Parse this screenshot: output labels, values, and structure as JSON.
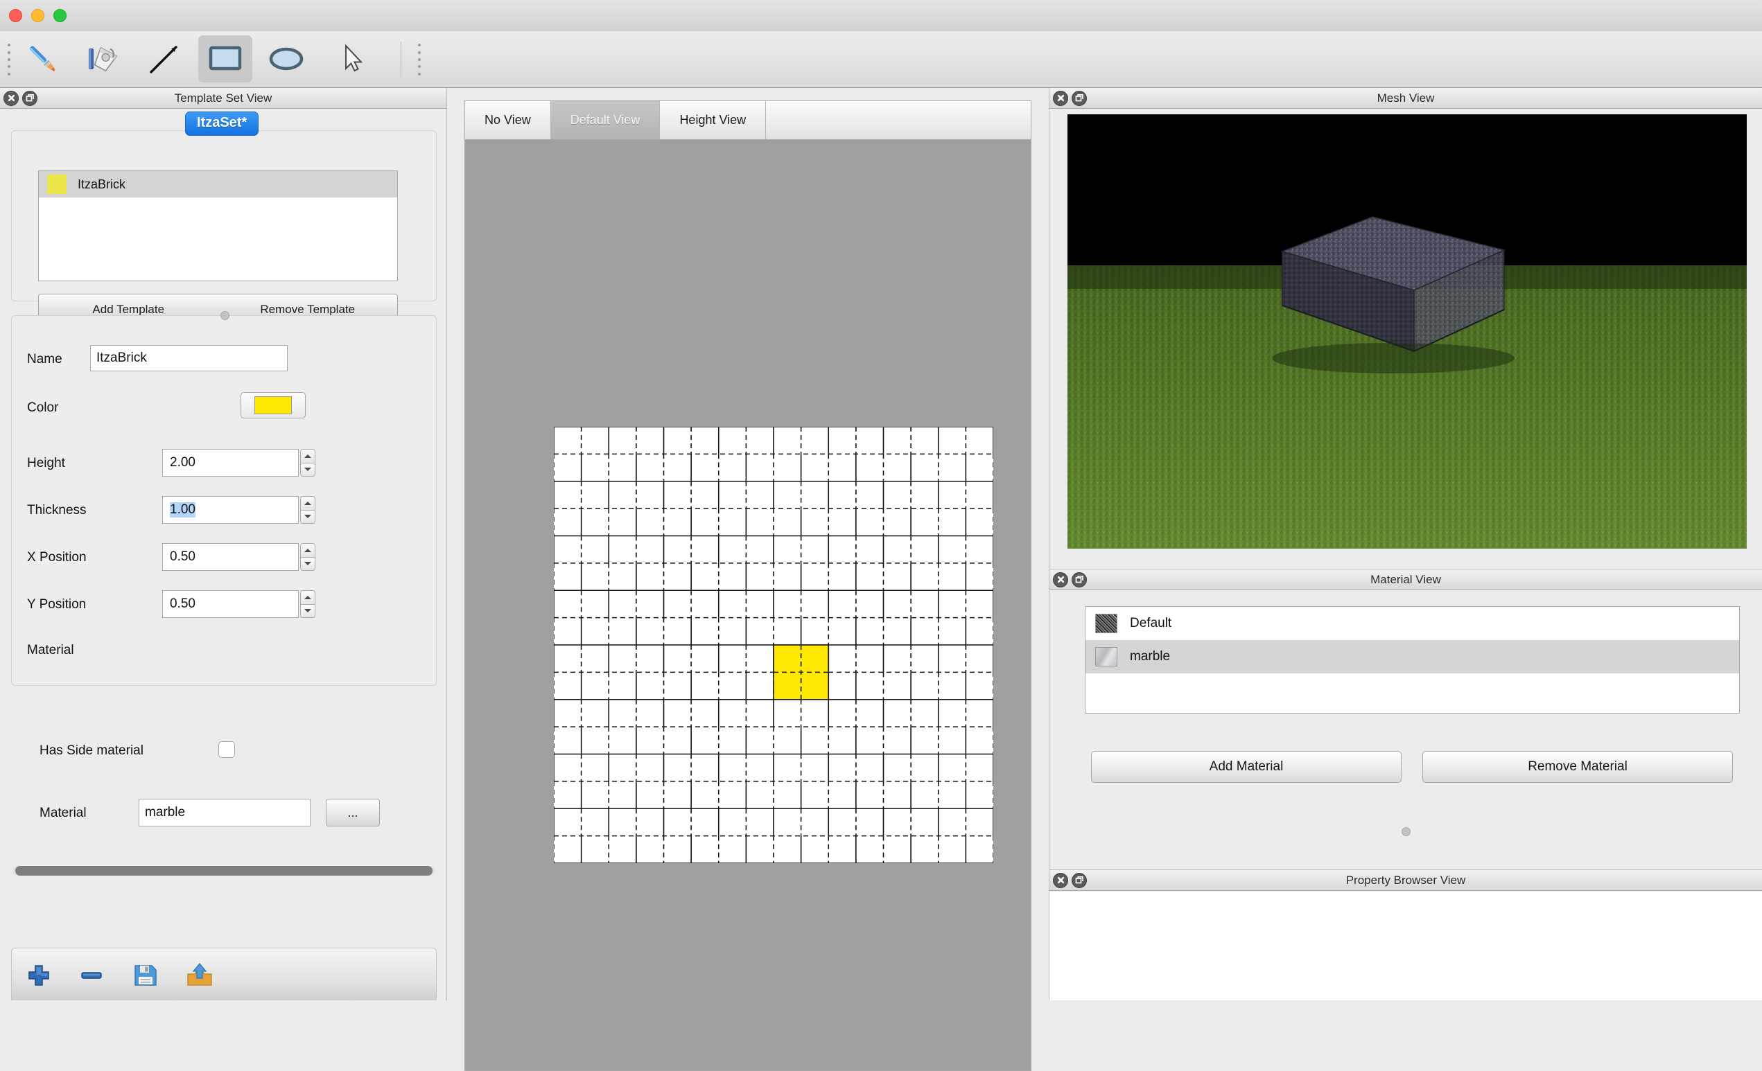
{
  "window": {
    "traffic_lights": [
      "close",
      "minimize",
      "zoom"
    ]
  },
  "toolbar": {
    "tools": [
      {
        "name": "brush-tool",
        "icon": "paintbrush-icon",
        "active": false
      },
      {
        "name": "bucket-tool",
        "icon": "paint-bucket-icon",
        "active": false
      },
      {
        "name": "line-tool",
        "icon": "line-icon",
        "active": false
      },
      {
        "name": "rectangle-tool",
        "icon": "rectangle-icon",
        "active": true
      },
      {
        "name": "ellipse-tool",
        "icon": "ellipse-icon",
        "active": false
      },
      {
        "name": "select-tool",
        "icon": "cursor-arrow-icon",
        "active": false
      }
    ]
  },
  "template_set_view": {
    "title": "Template Set View",
    "set_name": "ItzaSet*",
    "templates": [
      {
        "label": "ItzaBrick",
        "color": "#ece64b",
        "selected": true
      }
    ],
    "add_button": "Add Template",
    "remove_button": "Remove Template",
    "properties": {
      "name_label": "Name",
      "name_value": "ItzaBrick",
      "color_label": "Color",
      "color_value": "#ffe800",
      "height_label": "Height",
      "height_value": "2.00",
      "thickness_label": "Thickness",
      "thickness_value": "1.00",
      "x_position_label": "X Position",
      "x_position_value": "0.50",
      "y_position_label": "Y Position",
      "y_position_value": "0.50",
      "material_section_label": "Material",
      "has_side_material_label": "Has Side material",
      "has_side_material_checked": false,
      "material_label": "Material",
      "material_value": "marble",
      "material_browse_button": "..."
    },
    "bottom_actions": [
      {
        "name": "add-icon",
        "label": "Add"
      },
      {
        "name": "remove-icon",
        "label": "Remove"
      },
      {
        "name": "save-icon",
        "label": "Save"
      },
      {
        "name": "export-icon",
        "label": "Export"
      }
    ]
  },
  "center_view": {
    "tabs": [
      {
        "label": "No View",
        "active": false
      },
      {
        "label": "Default View",
        "active": true
      },
      {
        "label": "Height View",
        "active": false
      }
    ],
    "canvas": {
      "background": "#a0a0a0",
      "grid_background": "#ffffff",
      "selection_color": "#ffe800",
      "grid_columns": 16,
      "grid_rows": 16,
      "selection": {
        "col": 8,
        "row": 8,
        "width": 2,
        "height": 2
      }
    }
  },
  "mesh_view": {
    "title": "Mesh View",
    "sky_color": "#000000",
    "ground_color": "#4c6b25",
    "object_color": "#4a4a5e"
  },
  "material_view": {
    "title": "Material View",
    "materials": [
      {
        "label": "Default",
        "selected": false
      },
      {
        "label": "marble",
        "selected": true
      }
    ],
    "add_button": "Add Material",
    "remove_button": "Remove Material"
  },
  "property_browser_view": {
    "title": "Property Browser View"
  }
}
